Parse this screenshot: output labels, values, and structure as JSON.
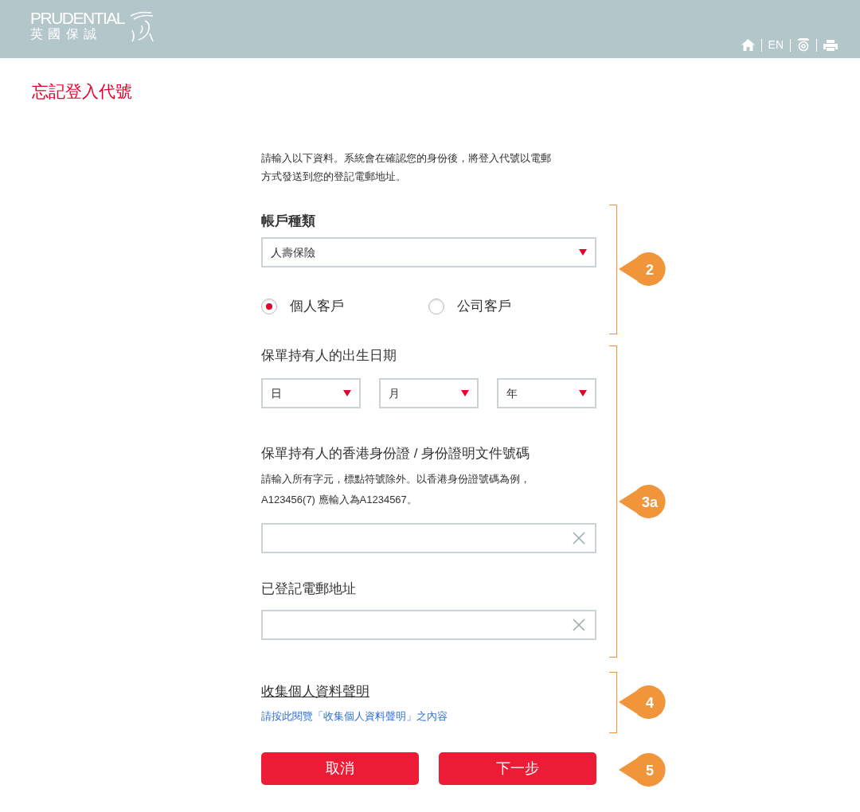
{
  "header": {
    "logo_text": "PRUDENTIAL",
    "logo_subtext": "英 國 保 誠",
    "language": "EN"
  },
  "title": "忘記登入代號",
  "intro_lines": [
    "請輸入以下資料。系統會在確認您的身份後，將登入代號以電郵",
    "方式發送到您的登記電郵地址。"
  ],
  "account_section": {
    "callout": "2",
    "label": "帳戶種類",
    "select_value": "人壽保險",
    "radios": [
      {
        "label": "個人客戶",
        "selected": true
      },
      {
        "label": "公司客戶",
        "selected": false
      }
    ]
  },
  "identity_section": {
    "callout": "3a",
    "dob_label": "保單持有人的出生日期",
    "dob_selects": [
      {
        "value": "日"
      },
      {
        "value": "月"
      },
      {
        "value": "年"
      }
    ],
    "id_label": "保單持有人的香港身份證 / 身份證明文件號碼",
    "id_hint_lines": [
      "請輸入所有字元，標點符號除外。以香港身份證號碼為例，",
      "A123456(7) 應輸入為A1234567。"
    ],
    "email_label": "已登記電郵地址"
  },
  "privacy_section": {
    "callout": "4",
    "heading": "收集個人資料聲明",
    "link": "請按此閱覽「收集個人資料聲明」之內容"
  },
  "buttons_section": {
    "callout": "5",
    "buttons": [
      "取消",
      "下一步"
    ]
  }
}
